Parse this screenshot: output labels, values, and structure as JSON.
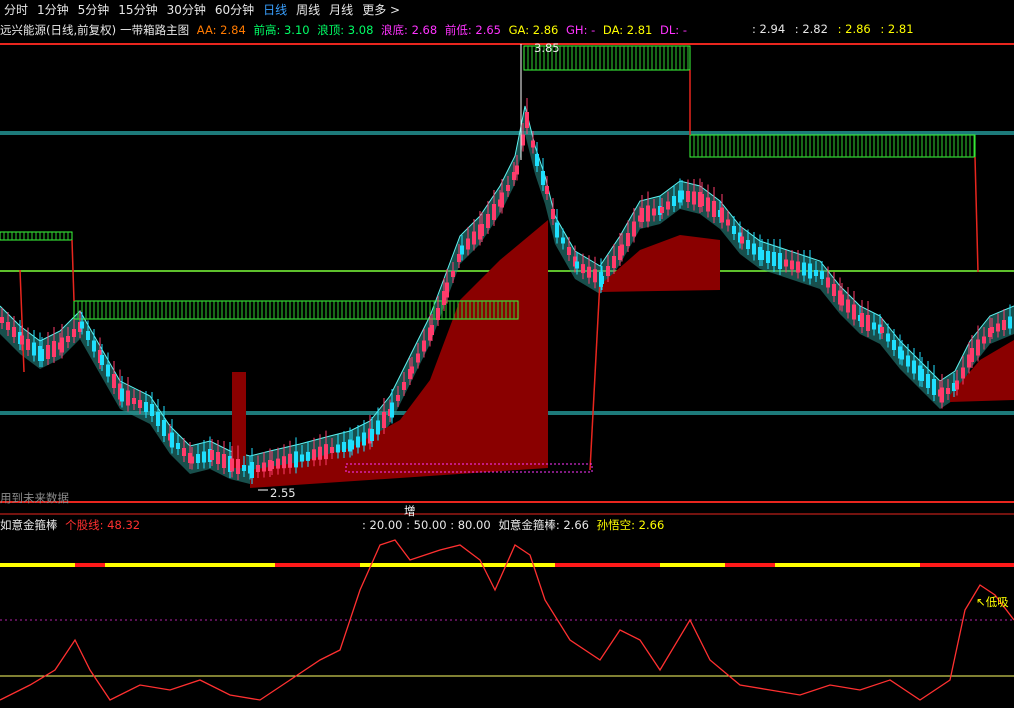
{
  "toolbar": {
    "items": [
      "分时",
      "1分钟",
      "5分钟",
      "15分钟",
      "30分钟",
      "60分钟",
      "日线",
      "周线",
      "月线",
      "更多 >"
    ],
    "active_index": 6
  },
  "legend": {
    "title": "远兴能源(日线,前复权)",
    "indicator": "一带箱路主图",
    "aa": "AA: 2.84",
    "qiangao": "前高: 3.10",
    "langding": "浪顶: 3.08",
    "langdi": "浪底: 2.68",
    "qiandi": "前低: 2.65",
    "ga": "GA: 2.86",
    "gh": "GH: -",
    "da": "DA: 2.81",
    "dl": "DL: -"
  },
  "right_legend": {
    "v1": ": 2.94",
    "v2": ": 2.82",
    "v3": ": 2.86",
    "v4": ": 2.81"
  },
  "annotations": {
    "high_label": "3.85",
    "low_label": "2.55",
    "future_data_label": "用到未来数据",
    "zeng_label": "增",
    "dixi_label": "低吸"
  },
  "sub_legend": {
    "name": "如意金箍棒",
    "geguxian": "个股线: 48.32",
    "levels": ": 20.00 : 50.00 : 80.00",
    "name2": "如意金箍棒: 2.66",
    "wukong": "孙悟空: 2.66"
  },
  "colors": {
    "up": "#ff3b6b",
    "down": "#1fe0ff",
    "accent_blue": "#39a0ff",
    "legend_orange": "#ff7a00",
    "legend_green": "#00ff66",
    "legend_magenta": "#ff33ff",
    "legend_yellow": "#ffff00",
    "line_red": "#e8261e",
    "hline_teal": "#1d7a7a",
    "hline_green": "#7dff3a"
  }
}
